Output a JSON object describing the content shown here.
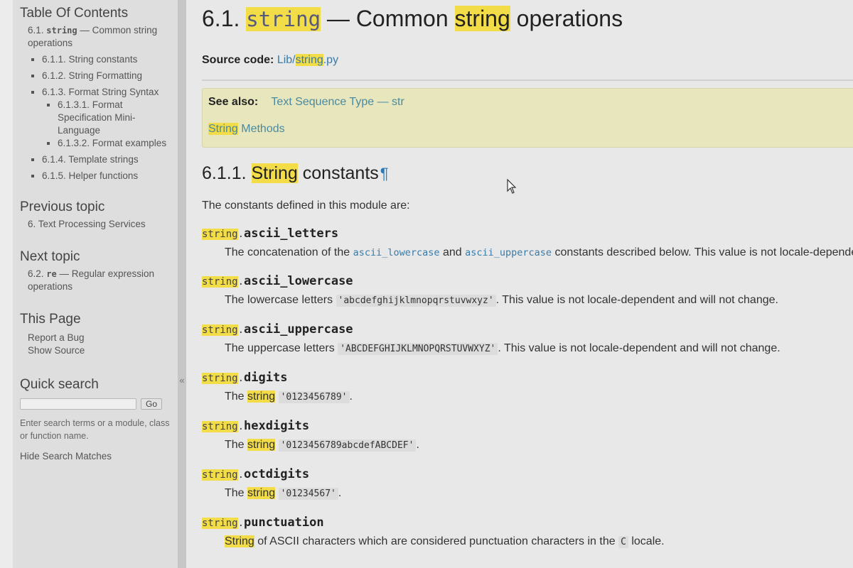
{
  "sidebar": {
    "toc_heading": "Table Of Contents",
    "toc_top": {
      "prefix": "6.1. ",
      "code": "string",
      "suffix": " — Common string operations"
    },
    "toc_items": [
      {
        "label": "6.1.1. String constants"
      },
      {
        "label": "6.1.2. String Formatting"
      },
      {
        "label": "6.1.3. Format String Syntax",
        "children": [
          {
            "label": "6.1.3.1. Format Specification Mini-Language"
          },
          {
            "label": "6.1.3.2. Format examples"
          }
        ]
      },
      {
        "label": "6.1.4. Template strings"
      },
      {
        "label": "6.1.5. Helper functions"
      }
    ],
    "previous_heading": "Previous topic",
    "previous_link": "6. Text Processing Services",
    "next_heading": "Next topic",
    "next_link": {
      "prefix": "6.2. ",
      "code": "re",
      "suffix": " — Regular expression operations"
    },
    "this_page_heading": "This Page",
    "report_bug": "Report a Bug",
    "show_source": "Show Source",
    "quick_search_heading": "Quick search",
    "search_value": "",
    "go_label": "Go",
    "search_help": "Enter search terms or a module, class or function name.",
    "hide_matches": "Hide Search Matches",
    "collapse_glyph": "«"
  },
  "main": {
    "title": {
      "prefix": "6.1. ",
      "code": "string",
      "dash": " — Common ",
      "hl": "string",
      "suffix": " operations"
    },
    "source_label": "Source code:",
    "source_link": {
      "pre": "Lib/",
      "hl": "string",
      "post": ".py"
    },
    "see_also_label": "See also:",
    "see_also_link1": "Text Sequence Type — str",
    "see_also_link2": {
      "hl": "String",
      "rest": " Methods"
    },
    "section": {
      "number": "6.1.1. ",
      "hl": "String",
      "rest": " constants",
      "pilcrow": "¶"
    },
    "intro": "The constants defined in this module are:",
    "module_prefix": "string",
    "entries": [
      {
        "name": "ascii_letters",
        "desc_parts": [
          {
            "t": "text",
            "v": "The concatenation of the "
          },
          {
            "t": "ref",
            "v": "ascii_lowercase"
          },
          {
            "t": "text",
            "v": " and "
          },
          {
            "t": "ref",
            "v": "ascii_uppercase"
          },
          {
            "t": "text",
            "v": " constants described below. This value is not locale-dependent."
          }
        ]
      },
      {
        "name": "ascii_lowercase",
        "desc_parts": [
          {
            "t": "text",
            "v": "The lowercase letters "
          },
          {
            "t": "lit",
            "v": "'abcdefghijklmnopqrstuvwxyz'"
          },
          {
            "t": "text",
            "v": ". This value is not locale-dependent and will not change."
          }
        ]
      },
      {
        "name": "ascii_uppercase",
        "desc_parts": [
          {
            "t": "text",
            "v": "The uppercase letters "
          },
          {
            "t": "lit",
            "v": "'ABCDEFGHIJKLMNOPQRSTUVWXYZ'"
          },
          {
            "t": "text",
            "v": ". This value is not locale-dependent and will not change."
          }
        ]
      },
      {
        "name": "digits",
        "desc_parts": [
          {
            "t": "text",
            "v": "The "
          },
          {
            "t": "hl",
            "v": "string"
          },
          {
            "t": "text",
            "v": " "
          },
          {
            "t": "lit",
            "v": "'0123456789'"
          },
          {
            "t": "text",
            "v": "."
          }
        ]
      },
      {
        "name": "hexdigits",
        "desc_parts": [
          {
            "t": "text",
            "v": "The "
          },
          {
            "t": "hl",
            "v": "string"
          },
          {
            "t": "text",
            "v": " "
          },
          {
            "t": "lit",
            "v": "'0123456789abcdefABCDEF'"
          },
          {
            "t": "text",
            "v": "."
          }
        ]
      },
      {
        "name": "octdigits",
        "desc_parts": [
          {
            "t": "text",
            "v": "The "
          },
          {
            "t": "hl",
            "v": "string"
          },
          {
            "t": "text",
            "v": " "
          },
          {
            "t": "lit",
            "v": "'01234567'"
          },
          {
            "t": "text",
            "v": "."
          }
        ]
      },
      {
        "name": "punctuation",
        "desc_parts": [
          {
            "t": "hl",
            "v": "String"
          },
          {
            "t": "text",
            "v": " of ASCII characters which are considered punctuation characters in the "
          },
          {
            "t": "lit",
            "v": "C"
          },
          {
            "t": "text",
            "v": " locale."
          }
        ]
      }
    ]
  },
  "colors": {
    "highlight": "#f2dc47",
    "link": "#3a7ba8",
    "see_also_bg": "#e8e6bc",
    "sidebar_bg": "#dedede"
  }
}
